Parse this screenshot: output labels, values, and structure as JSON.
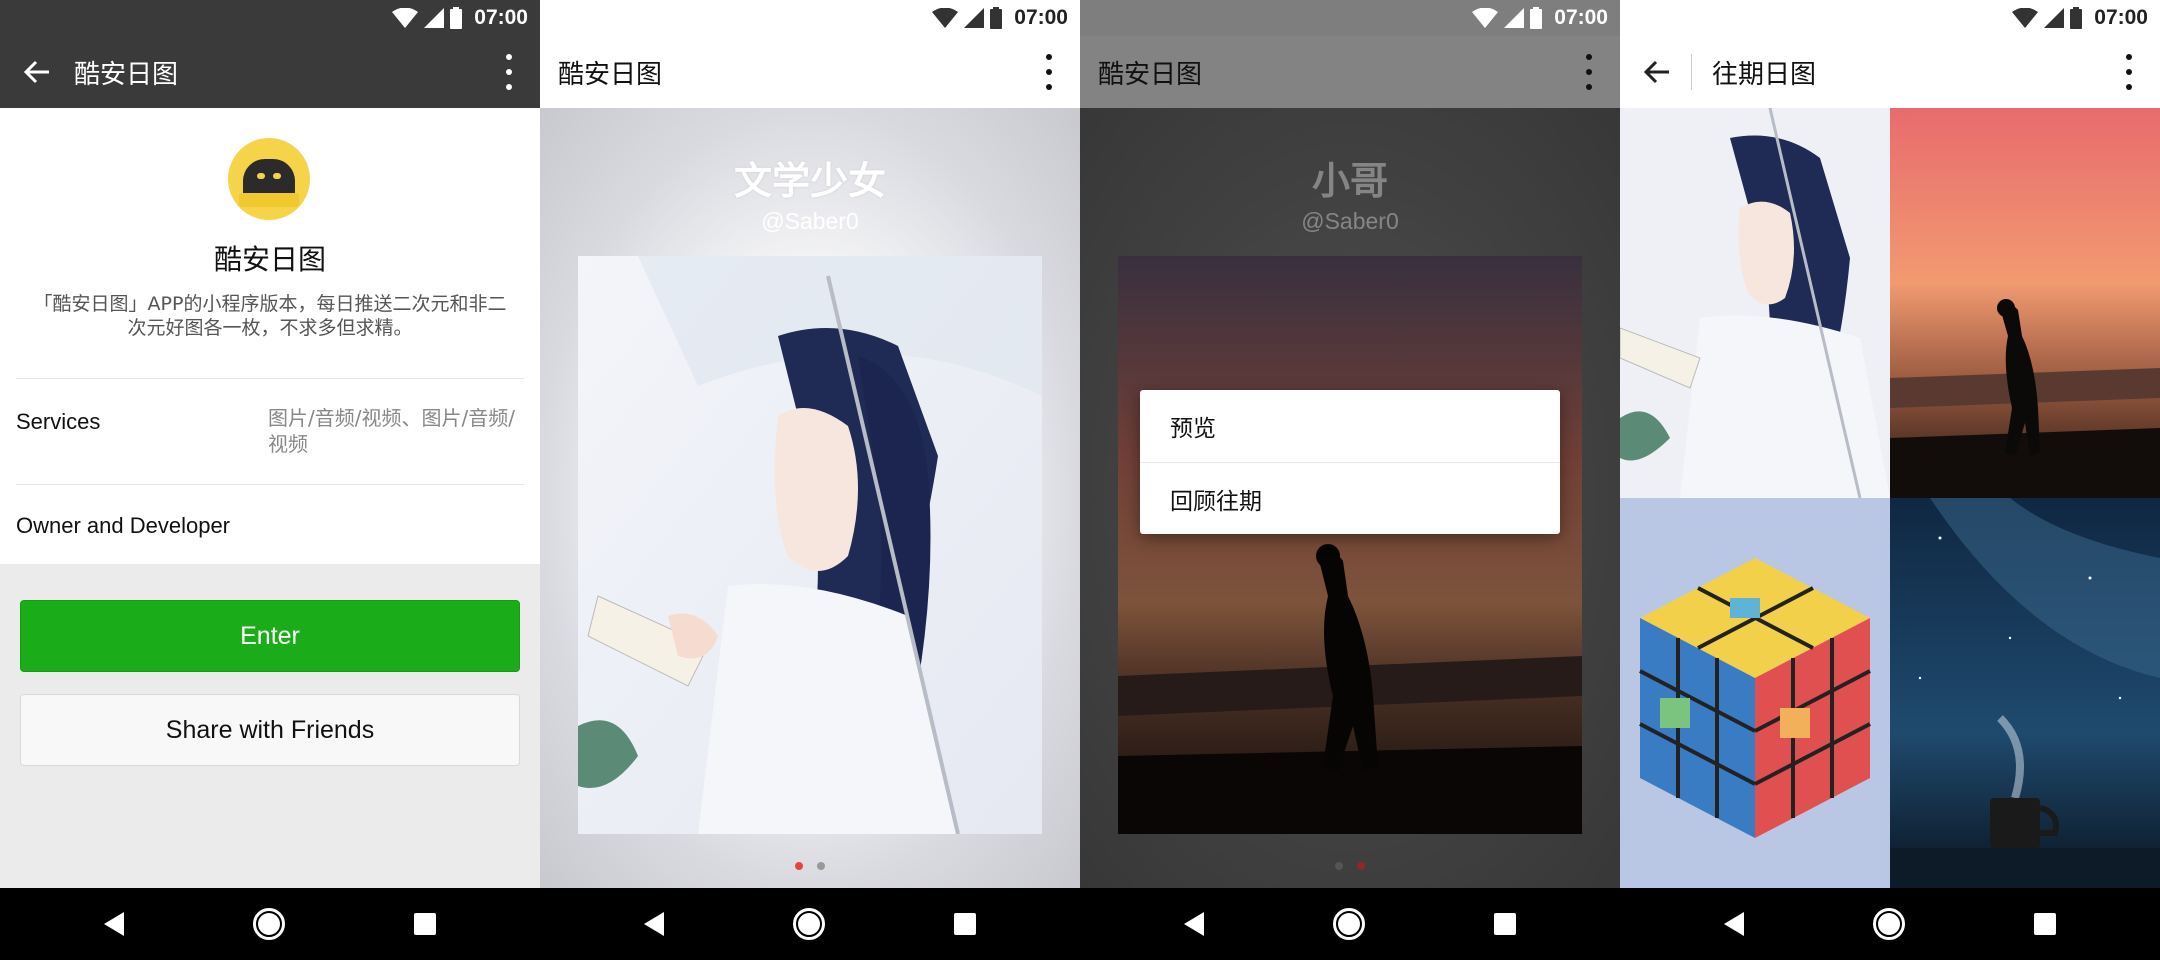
{
  "status": {
    "time": "07:00"
  },
  "screen1": {
    "title": "酷安日图",
    "app_name": "酷安日图",
    "description": "「酷安日图」APP的小程序版本，每日推送二次元和非二次元好图各一枚，不求多但求精。",
    "services_label": "Services",
    "services_value": "图片/音频/视频、图片/音频/视频",
    "owner_label": "Owner and Developer",
    "enter_label": "Enter",
    "share_label": "Share with Friends",
    "accent_color": "#1aad19"
  },
  "screen2": {
    "title": "酷安日图",
    "card_title": "文学少女",
    "card_author": "@Saber0",
    "image_name": "anime-girl-reading-image",
    "active_dot_color": "#e64340"
  },
  "screen3": {
    "title": "酷安日图",
    "card_title": "小哥",
    "card_author": "@Saber0",
    "image_name": "sunset-silhouette-image",
    "menu_items": [
      "预览",
      "回顾往期"
    ]
  },
  "screen4": {
    "title": "往期日图",
    "tiles": [
      "anime-girl-reading-image",
      "sunset-silhouette-image",
      "rubiks-cube-illustration-image",
      "starry-night-cup-image"
    ]
  }
}
